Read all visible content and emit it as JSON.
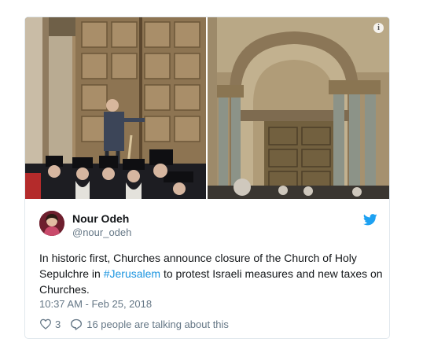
{
  "tweet": {
    "author": {
      "name": "Nour Odeh",
      "handle": "@nour_odeh"
    },
    "text": {
      "before": "In historic first, Churches announce closure of the Church of Holy Sepulchre in ",
      "hashtag": "#Jerusalem",
      "after": " to protest Israeli measures and new taxes on Churches."
    },
    "timestamp": "10:37 AM - Feb 25, 2018",
    "likes": "3",
    "conversation": "16 people are talking about this",
    "media": {
      "info_icon_glyph": "i"
    }
  },
  "colors": {
    "link": "#1b95e0",
    "twitter_blue": "#1da1f2",
    "muted": "#657786",
    "text": "#14171a",
    "border": "#e1e8ed"
  },
  "icons": {
    "brand": "twitter-bird-icon",
    "like": "heart-icon",
    "reply": "speech-bubble-icon",
    "info": "info-icon"
  }
}
